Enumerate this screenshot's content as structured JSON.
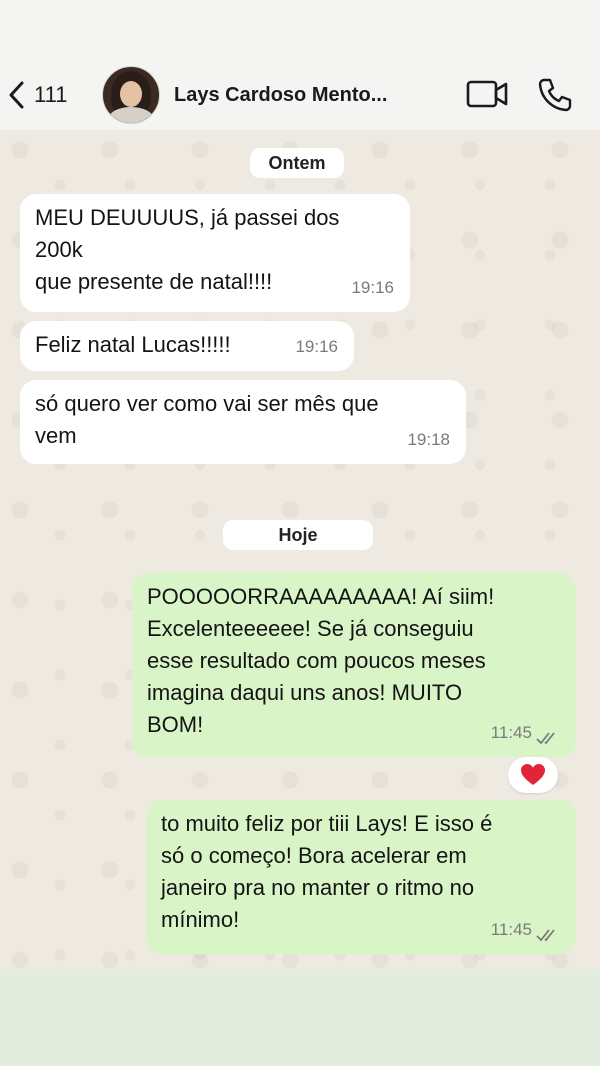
{
  "header": {
    "back_count": "111",
    "contact_name": "Lays Cardoso Mento..."
  },
  "dates": {
    "yesterday": "Ontem",
    "today": "Hoje"
  },
  "messages": [
    {
      "direction": "in",
      "text": "MEU DEUUUUS, já passei dos\n200k\nque presente de natal!!!!",
      "time": "19:16"
    },
    {
      "direction": "in",
      "text": "Feliz natal Lucas!!!!!",
      "time": "19:16"
    },
    {
      "direction": "in",
      "text": "só quero ver como vai ser mês que\nvem",
      "time": "19:18"
    },
    {
      "direction": "out",
      "text": "POOOOORRAAAAAAAAA! Aí siim!\nExcelenteeeeee! Se já conseguiu\nesse resultado com poucos meses\nimagina daqui uns anos! MUITO\nBOM!",
      "time": "11:45",
      "status": "read"
    },
    {
      "direction": "out",
      "text": "to muito feliz por tiii Lays! E isso é\nsó o começo! Bora acelerar em\njaneiro pra no manter o ritmo no\nmínimo!",
      "time": "11:45",
      "status": "read"
    }
  ],
  "reaction": {
    "icon": "heart-icon",
    "color": "#e0243a"
  },
  "colors": {
    "incoming": "#ffffff",
    "outgoing": "#d9f5c8",
    "wallpaper": "#efeae1"
  }
}
